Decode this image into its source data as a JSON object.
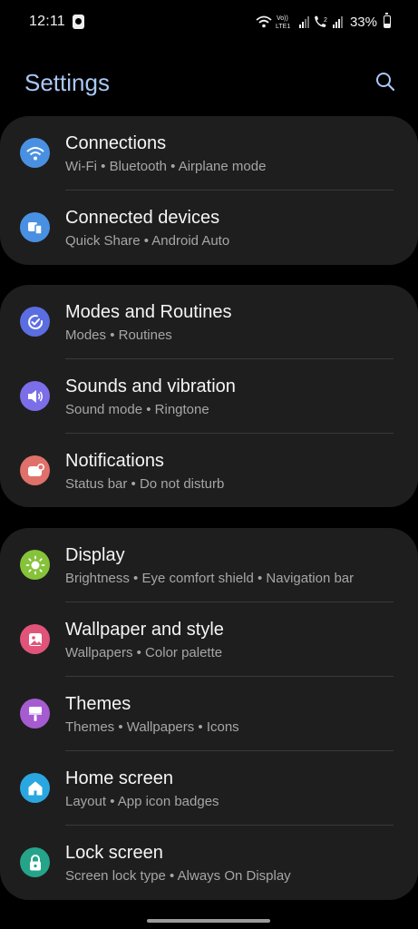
{
  "status_bar": {
    "time": "12:11",
    "lte_label": "LTE1",
    "volte_label": "Vo))",
    "sim2_label": "2",
    "battery": "33%"
  },
  "header": {
    "title": "Settings",
    "search_icon": "search-icon"
  },
  "colors": {
    "title": "#a9c8f5",
    "card_bg": "#1e1e1e",
    "background": "#000000"
  },
  "groups": [
    {
      "items": [
        {
          "title": "Connections",
          "subtitle": "Wi-Fi  •  Bluetooth  •  Airplane mode",
          "icon": "wifi-icon",
          "color": "#4a90e2"
        },
        {
          "title": "Connected devices",
          "subtitle": "Quick Share  •  Android Auto",
          "icon": "devices-icon",
          "color": "#4a90e2"
        }
      ]
    },
    {
      "items": [
        {
          "title": "Modes and Routines",
          "subtitle": "Modes  •  Routines",
          "icon": "check-circle-icon",
          "color": "#5b6ee1"
        },
        {
          "title": "Sounds and vibration",
          "subtitle": "Sound mode  •  Ringtone",
          "icon": "volume-icon",
          "color": "#7b6ee8"
        },
        {
          "title": "Notifications",
          "subtitle": "Status bar  •  Do not disturb",
          "icon": "notification-icon",
          "color": "#e0706a"
        }
      ]
    },
    {
      "items": [
        {
          "title": "Display",
          "subtitle": "Brightness  •  Eye comfort shield  •  Navigation bar",
          "icon": "sun-icon",
          "color": "#86c23a"
        },
        {
          "title": "Wallpaper and style",
          "subtitle": "Wallpapers  •  Color palette",
          "icon": "image-icon",
          "color": "#e0547a"
        },
        {
          "title": "Themes",
          "subtitle": "Themes  •  Wallpapers  •  Icons",
          "icon": "brush-icon",
          "color": "#a65bd1"
        },
        {
          "title": "Home screen",
          "subtitle": "Layout  •  App icon badges",
          "icon": "home-icon",
          "color": "#2aa7e0"
        },
        {
          "title": "Lock screen",
          "subtitle": "Screen lock type  •  Always On Display",
          "icon": "lock-icon",
          "color": "#25a48a"
        }
      ]
    }
  ]
}
